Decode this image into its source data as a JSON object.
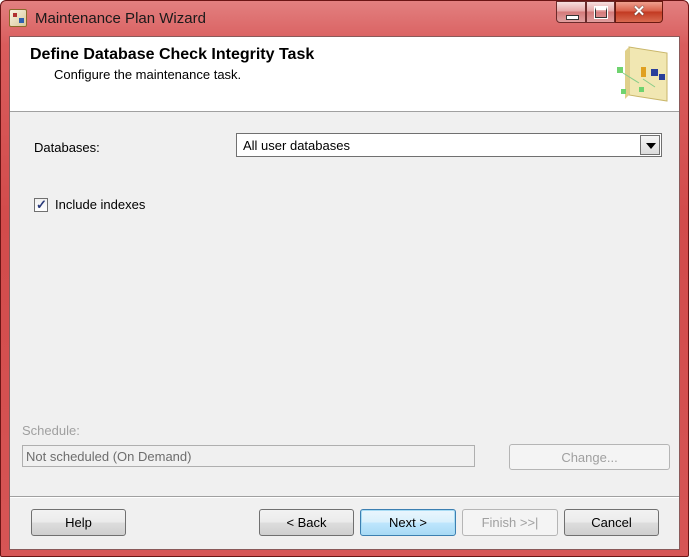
{
  "window": {
    "title": "Maintenance Plan Wizard"
  },
  "header": {
    "title": "Define Database Check Integrity Task",
    "subtitle": "Configure the maintenance task."
  },
  "form": {
    "databases_label": "Databases:",
    "databases_value": "All user databases",
    "include_indexes_label": "Include indexes",
    "include_indexes_checked": true,
    "check_glyph": "✓",
    "schedule_label": "Schedule:",
    "schedule_value": "Not scheduled (On Demand)",
    "change_button": "Change..."
  },
  "footer": {
    "help": "Help",
    "back": "< Back",
    "next": "Next >",
    "finish": "Finish >>|",
    "cancel": "Cancel"
  },
  "icons": {
    "close": "✕"
  }
}
